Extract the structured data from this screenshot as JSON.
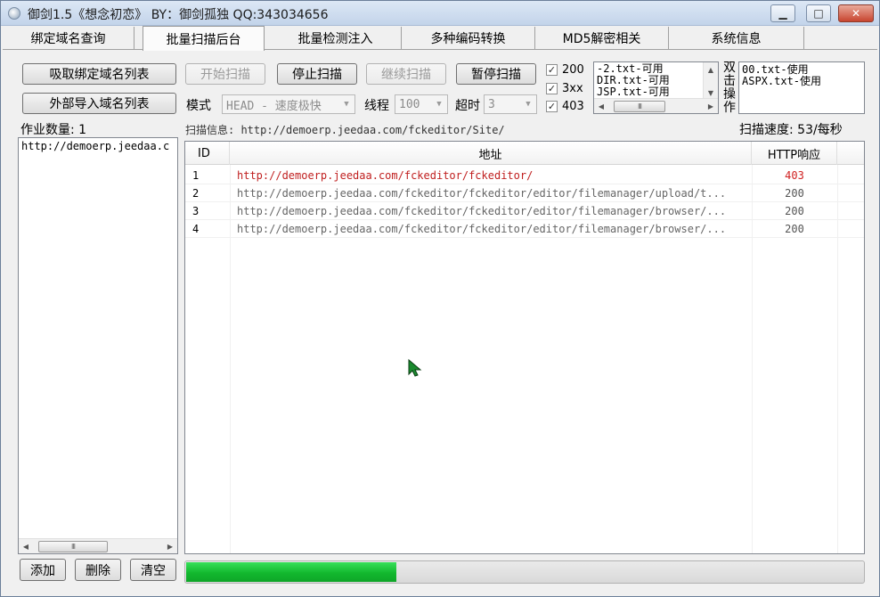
{
  "window": {
    "title": "御剑1.5《想念初恋》 BY：御剑孤独 QQ:343034656",
    "minimize_glyph": "▁",
    "maximize_glyph": "□",
    "close_glyph": "✕"
  },
  "tabs": [
    {
      "label": "绑定域名查询",
      "active": false
    },
    {
      "label": "批量扫描后台",
      "active": true
    },
    {
      "label": "批量检测注入",
      "active": false
    },
    {
      "label": "多种编码转换",
      "active": false
    },
    {
      "label": "MD5解密相关",
      "active": false
    },
    {
      "label": "系统信息",
      "active": false
    }
  ],
  "left_panel": {
    "fetch_domains_label": "吸取绑定域名列表",
    "import_domains_label": "外部导入域名列表",
    "job_count_label": "作业数量: 1",
    "domains": [
      "http://demoerp.jeedaa.c"
    ],
    "add_label": "添加",
    "delete_label": "删除",
    "clear_label": "清空"
  },
  "toolbar": {
    "start_label": "开始扫描",
    "stop_label": "停止扫描",
    "continue_label": "继续扫描",
    "pause_label": "暂停扫描",
    "mode_label": "模式",
    "mode_value": "HEAD - 速度极快",
    "threads_label": "线程",
    "threads_value": "100",
    "timeout_label": "超时",
    "timeout_value": "3"
  },
  "status_filters": [
    {
      "label": "200",
      "checked": true
    },
    {
      "label": "3xx",
      "checked": true
    },
    {
      "label": "403",
      "checked": true
    }
  ],
  "dict_lists": {
    "available": [
      "-2.txt-可用",
      "DIR.txt-可用",
      "JSP.txt-可用"
    ],
    "double_click_hint": "双击操作",
    "in_use": [
      "00.txt-使用",
      "ASPX.txt-使用"
    ]
  },
  "scan_info": {
    "label": "扫描信息: http://demoerp.jeedaa.com/fckeditor/Site/",
    "speed": "扫描速度: 53/每秒"
  },
  "results": {
    "columns": [
      "ID",
      "地址",
      "HTTP响应"
    ],
    "rows": [
      {
        "id": "1",
        "url": "http://demoerp.jeedaa.com/fckeditor/fckeditor/",
        "code": "403"
      },
      {
        "id": "2",
        "url": "http://demoerp.jeedaa.com/fckeditor/fckeditor/editor/filemanager/upload/t...",
        "code": "200"
      },
      {
        "id": "3",
        "url": "http://demoerp.jeedaa.com/fckeditor/fckeditor/editor/filemanager/browser/...",
        "code": "200"
      },
      {
        "id": "4",
        "url": "http://demoerp.jeedaa.com/fckeditor/fckeditor/editor/filemanager/browser/...",
        "code": "200"
      }
    ]
  },
  "progress": {
    "fraction": 0.31
  },
  "colors": {
    "code_403": "#d02020",
    "code_200": "#555555",
    "url_403": "#c02020",
    "url_200": "#666666",
    "progress_fill": "#12b82e"
  },
  "scrollbar_thumb_glyph": "III",
  "scroll_glyphs": {
    "up": "▲",
    "down": "▼",
    "left": "◀",
    "right": "▶"
  },
  "check_glyph": "✓"
}
